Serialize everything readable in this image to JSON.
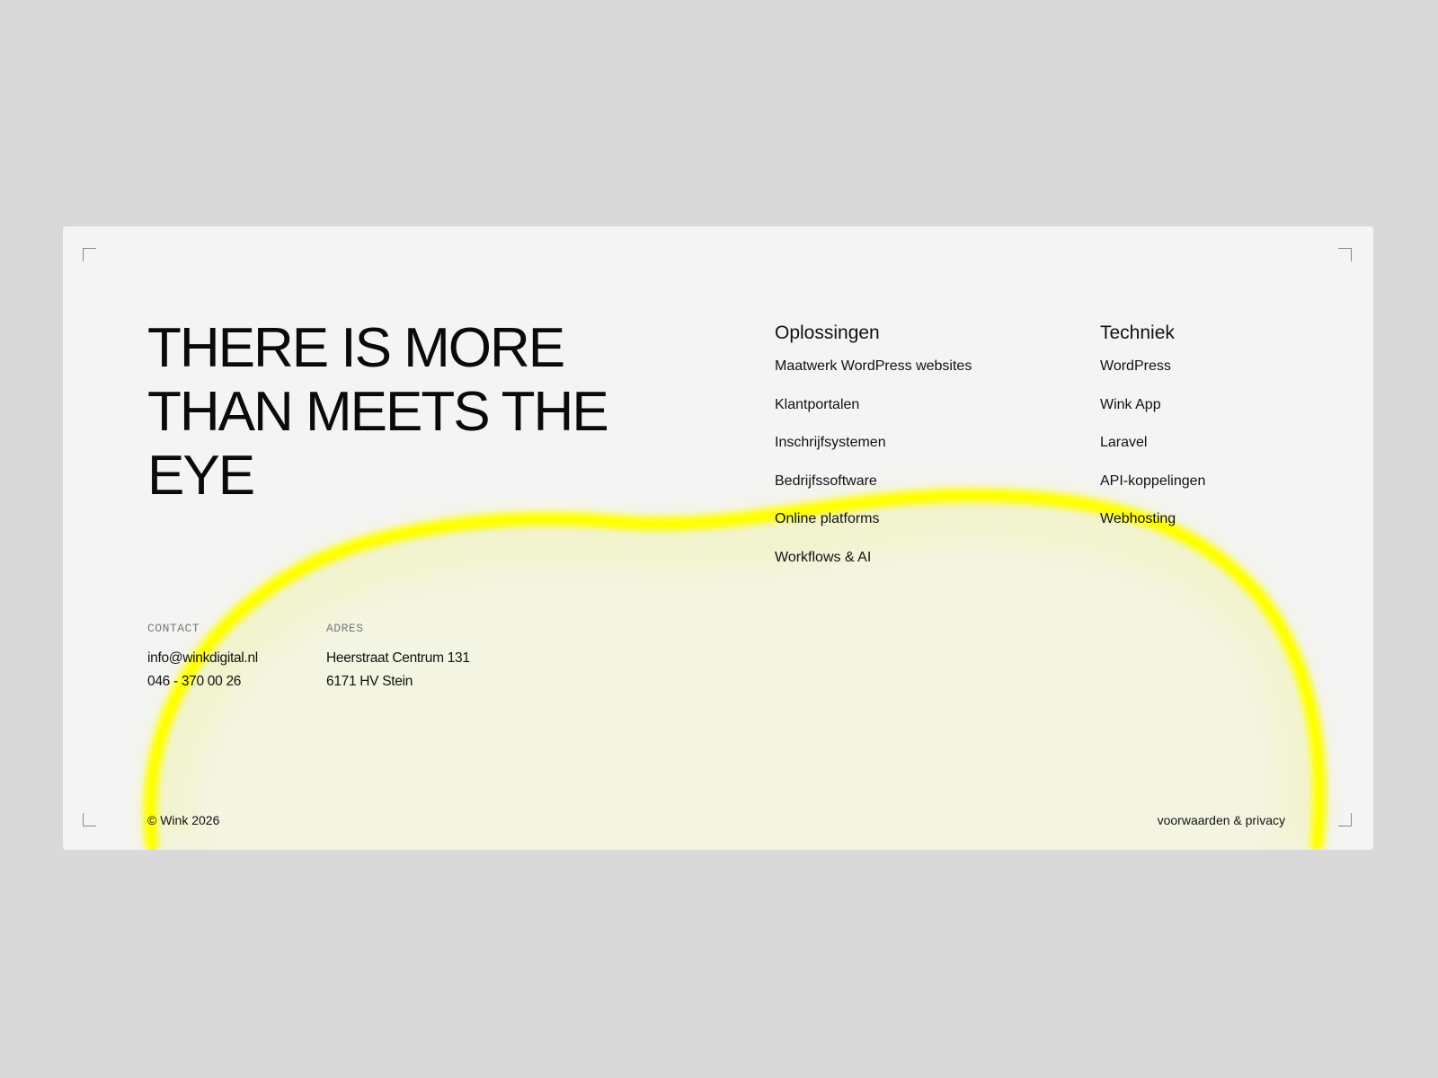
{
  "headline": "THERE IS MORE THAN MEETS THE EYE",
  "nav": {
    "solutions": {
      "heading": "Oplossingen",
      "items": [
        "Maatwerk WordPress websites",
        "Klantportalen",
        "Inschrijfsystemen",
        "Bedrijfssoftware",
        "Online platforms",
        "Workflows & AI"
      ]
    },
    "tech": {
      "heading": "Techniek",
      "items": [
        "WordPress",
        "Wink App",
        "Laravel",
        "API-koppelingen",
        "Webhosting"
      ]
    }
  },
  "contact": {
    "label": "CONTACT",
    "email": "info@winkdigital.nl",
    "phone": "046 - 370 00 26"
  },
  "address": {
    "label": "ADRES",
    "street": "Heerstraat Centrum 131",
    "city": "6171 HV Stein"
  },
  "footer": {
    "copyright": "© Wink 2026",
    "legal_link": "voorwaarden & privacy"
  },
  "colors": {
    "background": "#d9d9d9",
    "card": "#f4f4f4",
    "accent": "#ffff00",
    "text": "#111111"
  }
}
